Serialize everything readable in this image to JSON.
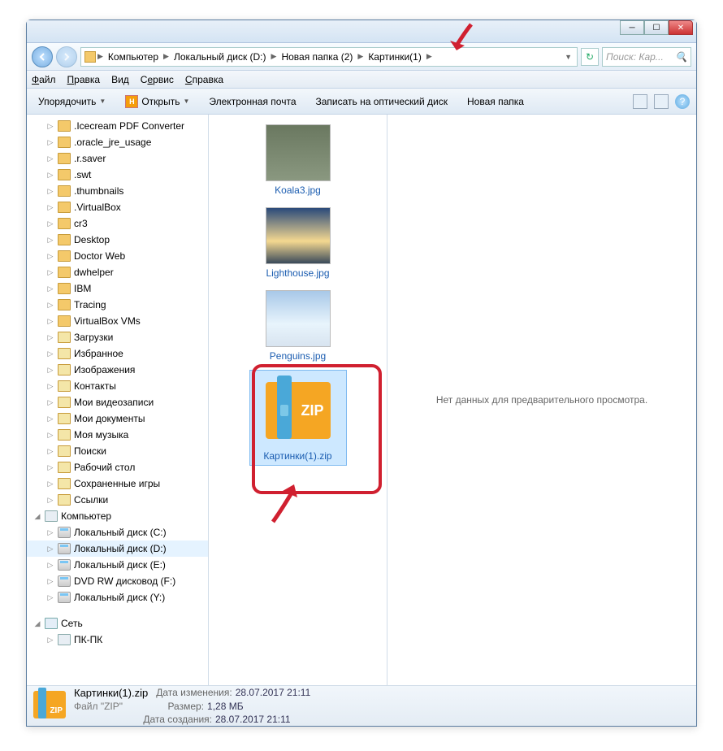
{
  "breadcrumb": {
    "root": "Компьютер",
    "disk": "Локальный диск (D:)",
    "folder": "Новая папка (2)",
    "current": "Картинки(1)"
  },
  "search": {
    "placeholder": "Поиск: Кар..."
  },
  "menu": {
    "file": "Файл",
    "edit": "Правка",
    "view": "Вид",
    "service": "Сервис",
    "help": "Справка"
  },
  "toolbar": {
    "organize": "Упорядочить",
    "open": "Открыть",
    "email": "Электронная почта",
    "burn": "Записать на оптический диск",
    "newfolder": "Новая папка"
  },
  "tree": [
    {
      "label": ".Icecream PDF Converter",
      "icon": "folder"
    },
    {
      "label": ".oracle_jre_usage",
      "icon": "folder"
    },
    {
      "label": ".r.saver",
      "icon": "folder"
    },
    {
      "label": ".swt",
      "icon": "folder"
    },
    {
      "label": ".thumbnails",
      "icon": "folder"
    },
    {
      "label": ".VirtualBox",
      "icon": "folder"
    },
    {
      "label": "cr3",
      "icon": "folder"
    },
    {
      "label": "Desktop",
      "icon": "folder"
    },
    {
      "label": "Doctor Web",
      "icon": "folder"
    },
    {
      "label": "dwhelper",
      "icon": "folder"
    },
    {
      "label": "IBM",
      "icon": "folder"
    },
    {
      "label": "Tracing",
      "icon": "folder"
    },
    {
      "label": "VirtualBox VMs",
      "icon": "folder"
    },
    {
      "label": "Загрузки",
      "icon": "special"
    },
    {
      "label": "Избранное",
      "icon": "special"
    },
    {
      "label": "Изображения",
      "icon": "special"
    },
    {
      "label": "Контакты",
      "icon": "special"
    },
    {
      "label": "Мои видеозаписи",
      "icon": "special"
    },
    {
      "label": "Мои документы",
      "icon": "special"
    },
    {
      "label": "Моя музыка",
      "icon": "special"
    },
    {
      "label": "Поиски",
      "icon": "special"
    },
    {
      "label": "Рабочий стол",
      "icon": "special"
    },
    {
      "label": "Сохраненные игры",
      "icon": "special"
    },
    {
      "label": "Ссылки",
      "icon": "special"
    }
  ],
  "computer_label": "Компьютер",
  "drives": [
    {
      "label": "Локальный диск (C:)",
      "sel": false
    },
    {
      "label": "Локальный диск (D:)",
      "sel": true
    },
    {
      "label": "Локальный диск (E:)",
      "sel": false
    },
    {
      "label": "DVD RW дисковод (F:)",
      "sel": false
    },
    {
      "label": "Локальный диск (Y:)",
      "sel": false
    }
  ],
  "network_label": "Сеть",
  "network_node": "ПК-ПК",
  "files": [
    {
      "label": "Koala3.jpg",
      "thumb": "koala"
    },
    {
      "label": "Lighthouse.jpg",
      "thumb": "light"
    },
    {
      "label": "Penguins.jpg",
      "thumb": "peng"
    },
    {
      "label": "Картинки(1).zip",
      "thumb": "zip",
      "sel": true
    }
  ],
  "preview": {
    "empty": "Нет данных для предварительного просмотра."
  },
  "status": {
    "name": "Картинки(1).zip",
    "type": "Файл \"ZIP\"",
    "mod_label": "Дата изменения:",
    "mod_value": "28.07.2017 21:11",
    "size_label": "Размер:",
    "size_value": "1,28 МБ",
    "created_label": "Дата создания:",
    "created_value": "28.07.2017 21:11"
  },
  "zip_badge": "ZIP"
}
